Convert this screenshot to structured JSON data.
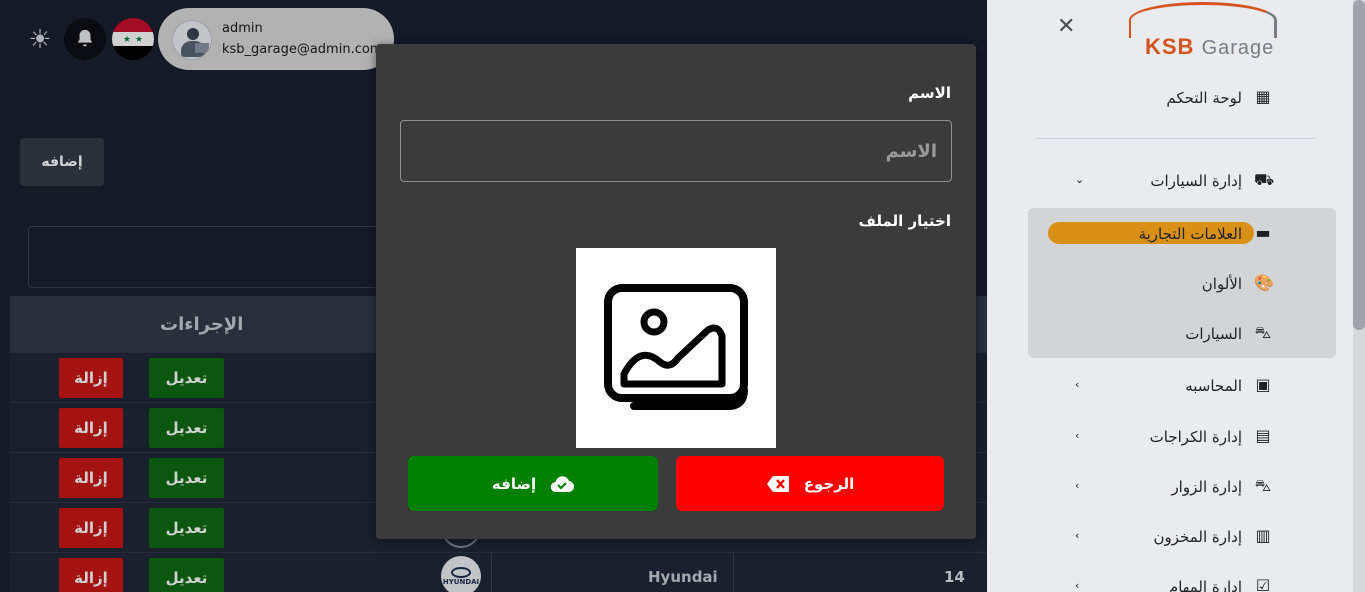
{
  "header": {
    "user_name": "admin",
    "user_email": "ksb_garage@admin.com"
  },
  "toolbar": {
    "add_label": "إضافه"
  },
  "table": {
    "actions_header": "الإجراءات",
    "rows": [
      {
        "edit": "تعديل",
        "remove": "إزالة"
      },
      {
        "edit": "تعديل",
        "remove": "إزالة"
      },
      {
        "edit": "تعديل",
        "remove": "إزالة"
      },
      {
        "edit": "تعديل",
        "remove": "إزالة"
      },
      {
        "edit": "تعديل",
        "remove": "إزالة"
      }
    ],
    "last_row": {
      "id": "14",
      "name": "Hyundai",
      "logo_text": "HYUNDAI"
    }
  },
  "sidebar": {
    "logo_main": "KSB",
    "logo_sub": "Garage",
    "items": [
      {
        "label": "لوحة التحكم",
        "icon": "dashboard-icon"
      },
      {
        "label": "إدارة السيارات",
        "icon": "car-manage-icon",
        "chevron": "down"
      },
      {
        "label": "العلامات التجارية",
        "icon": "brand-icon",
        "active": true
      },
      {
        "label": "الألوان",
        "icon": "palette-icon"
      },
      {
        "label": "السيارات",
        "icon": "car-icon"
      },
      {
        "label": "المحاسبه",
        "icon": "accounting-icon",
        "chevron": "left"
      },
      {
        "label": "إدارة الكراجات",
        "icon": "garage-icon",
        "chevron": "left"
      },
      {
        "label": "إدارة الزوار",
        "icon": "visitor-car-icon",
        "chevron": "left"
      },
      {
        "label": "إدارة المخزون",
        "icon": "inventory-icon",
        "chevron": "left"
      },
      {
        "label": "إدارة المهام",
        "icon": "tasks-icon",
        "chevron": "left"
      }
    ],
    "active_color": "#d89016"
  },
  "modal": {
    "name_label": "الاسم",
    "name_placeholder": "الاسم",
    "name_value": "",
    "file_label": "اختيار الملف",
    "back_label": "الرجوع",
    "add_label": "إضافه",
    "back_color": "#ff0000",
    "add_color": "#008000"
  }
}
